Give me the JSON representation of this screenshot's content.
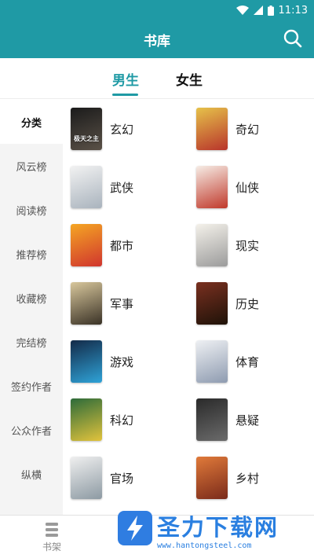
{
  "status": {
    "time": "11:13"
  },
  "header": {
    "title": "书库"
  },
  "tabs": [
    {
      "label": "男生"
    },
    {
      "label": "女生"
    }
  ],
  "sidebar": {
    "items": [
      {
        "label": "分类"
      },
      {
        "label": "风云榜"
      },
      {
        "label": "阅读榜"
      },
      {
        "label": "推荐榜"
      },
      {
        "label": "收藏榜"
      },
      {
        "label": "完结榜"
      },
      {
        "label": "签约作者"
      },
      {
        "label": "公众作者"
      },
      {
        "label": "纵横"
      }
    ]
  },
  "categories": [
    {
      "label": "玄幻",
      "cover_text": "极天之主",
      "colors": [
        "#1b1b1b",
        "#5a5147"
      ]
    },
    {
      "label": "奇幻",
      "cover_text": "",
      "colors": [
        "#e6c24a",
        "#b8342b"
      ]
    },
    {
      "label": "武侠",
      "cover_text": "",
      "colors": [
        "#f2f2f2",
        "#a9b3bd"
      ]
    },
    {
      "label": "仙侠",
      "cover_text": "",
      "colors": [
        "#f6ede6",
        "#c0392b"
      ]
    },
    {
      "label": "都市",
      "cover_text": "",
      "colors": [
        "#f5a623",
        "#d0352e"
      ]
    },
    {
      "label": "现实",
      "cover_text": "",
      "colors": [
        "#f4f1ea",
        "#9b9b9b"
      ]
    },
    {
      "label": "军事",
      "cover_text": "",
      "colors": [
        "#d8c79c",
        "#3a3226"
      ]
    },
    {
      "label": "历史",
      "cover_text": "",
      "colors": [
        "#7a3020",
        "#1e1208"
      ]
    },
    {
      "label": "游戏",
      "cover_text": "",
      "colors": [
        "#132a48",
        "#2fa3d8"
      ]
    },
    {
      "label": "体育",
      "cover_text": "",
      "colors": [
        "#eef0f3",
        "#8e9bb0"
      ]
    },
    {
      "label": "科幻",
      "cover_text": "",
      "colors": [
        "#2d6b3a",
        "#e2c33c"
      ]
    },
    {
      "label": "悬疑",
      "cover_text": "",
      "colors": [
        "#2a2a2a",
        "#6b6b6b"
      ]
    },
    {
      "label": "官场",
      "cover_text": "",
      "colors": [
        "#efefef",
        "#8d9aa3"
      ]
    },
    {
      "label": "乡村",
      "cover_text": "",
      "colors": [
        "#e07a3a",
        "#7a2a1a"
      ]
    }
  ],
  "bottom": {
    "shelf_label": "书架"
  },
  "watermark": {
    "title": "圣力下载网",
    "url": "www.hantongsteel.com"
  },
  "colors": {
    "primary": "#1f9aa5",
    "sidebar_bg": "#f4f4f4"
  }
}
